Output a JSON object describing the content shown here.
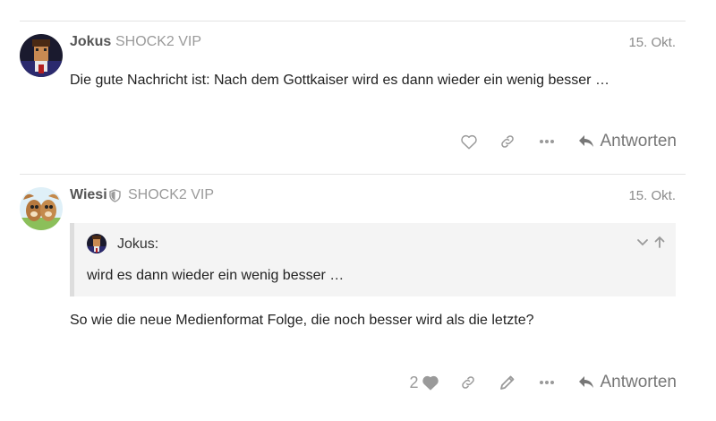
{
  "posts": [
    {
      "username": "Jokus",
      "group": "SHOCK2 VIP",
      "date": "15. Okt.",
      "text": "Die gute Nachricht ist: Nach dem Gottkaiser wird es dann wieder ein wenig besser …",
      "reply_label": "Antworten",
      "avatar_icon": "pirate-avatar"
    },
    {
      "username": "Wiesi",
      "group": "SHOCK2 VIP",
      "date": "15. Okt.",
      "moderator_icon": "shield-icon",
      "quote": {
        "author": "Jokus:",
        "text": "wird es dann wieder ein wenig besser …"
      },
      "text": "So wie die neue Medienformat Folge, die noch besser wird als die letzte?",
      "likes": "2",
      "reply_label": "Antworten",
      "avatar_icon": "chipmunks-avatar"
    }
  ],
  "colors": {
    "muted": "#9a9a9a",
    "quote_bg": "#f4f4f4",
    "quote_border": "#dddddd"
  }
}
